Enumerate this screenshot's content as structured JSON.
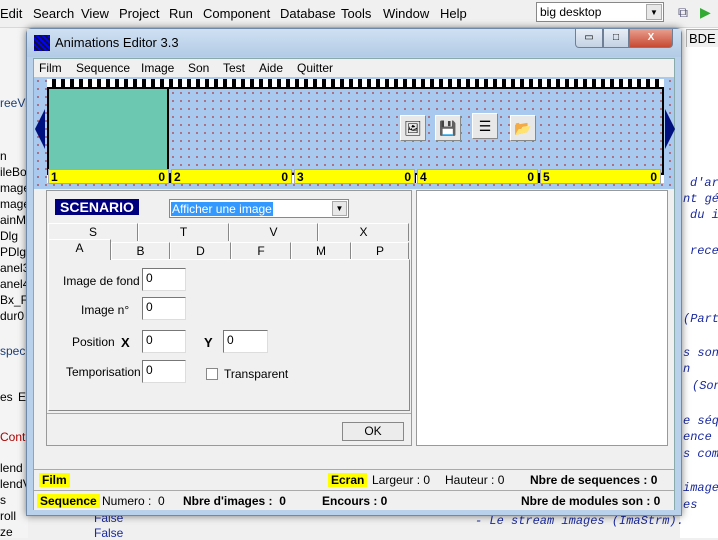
{
  "ide": {
    "menu": [
      "Edit",
      "Search",
      "View",
      "Project",
      "Run",
      "Component",
      "Database",
      "Tools",
      "Window",
      "Help"
    ],
    "desktop_combo": "big desktop",
    "left_fragments": [
      "reeVi",
      "n",
      "ileBo",
      "mage",
      "mage",
      "ainM",
      "Dlg",
      "PDlg",
      "anel3",
      "anel4",
      "Bx_F",
      "dur0",
      "spec",
      "es",
      "E",
      "Contro",
      "lend",
      "lendV",
      "s",
      "roll",
      "ze"
    ],
    "bottom_values": [
      "False",
      "False"
    ],
    "right_tab_fragment": "BDE",
    "code_fragments": [
      "d'ar",
      "nt gé",
      "du i",
      "rece",
      "(Part",
      "s son",
      "n",
      "(Son",
      "e séq",
      "ence",
      "s com",
      "image",
      "es"
    ],
    "code_last_line": "- Le stream images (ImaStrm)."
  },
  "window": {
    "title": "Animations Editor 3.3",
    "controls": {
      "minimize": "▭",
      "maximize": "□",
      "close": "X"
    },
    "menu": [
      "Film",
      "Sequence",
      "Image",
      "Son",
      "Test",
      "Aide",
      "Quitter"
    ],
    "toolbar_icons": [
      "open-image-icon",
      "save-image-icon",
      "properties-icon",
      "open-folder-icon"
    ],
    "frames": [
      {
        "num": "1",
        "count": "0"
      },
      {
        "num": "2",
        "count": "0"
      },
      {
        "num": "3",
        "count": "0"
      },
      {
        "num": "4",
        "count": "0"
      },
      {
        "num": "5",
        "count": "0"
      }
    ],
    "selected_frame": 1,
    "colors": {
      "film_bg": "#a9c9ee",
      "selected_frame": "#6cc8b0",
      "label_yellow": "#ffff00",
      "scenario_bg": "#00007f"
    },
    "scenario": {
      "label": "SCENARIO",
      "action": "Afficher une image",
      "tabs_row1": [
        "S",
        "T",
        "V",
        "X"
      ],
      "tabs_row2": [
        "A",
        "B",
        "D",
        "F",
        "M",
        "P"
      ],
      "active_tab": "A",
      "fields": {
        "image_de_fond": {
          "label": "Image de fond",
          "value": "0"
        },
        "image_n": {
          "label": "Image n°",
          "value": "0"
        },
        "position": {
          "label": "Position",
          "x_label": "X",
          "x": "0",
          "y_label": "Y",
          "y": "0"
        },
        "temporisation": {
          "label": "Temporisation",
          "value": "0"
        }
      },
      "transparent": {
        "label": "Transparent",
        "checked": false
      },
      "ok": "OK"
    },
    "status1": {
      "film": "Film",
      "ecran": "Ecran",
      "largeur": "Largeur : 0",
      "hauteur": "Hauteur : 0",
      "nb_seq": "Nbre de sequences : 0"
    },
    "status2": {
      "sequence": "Sequence",
      "numero": "Numero :  0",
      "nb_images": "Nbre d'images :  0",
      "encours": "Encours : 0",
      "nb_son": "Nbre de modules son : 0"
    }
  }
}
